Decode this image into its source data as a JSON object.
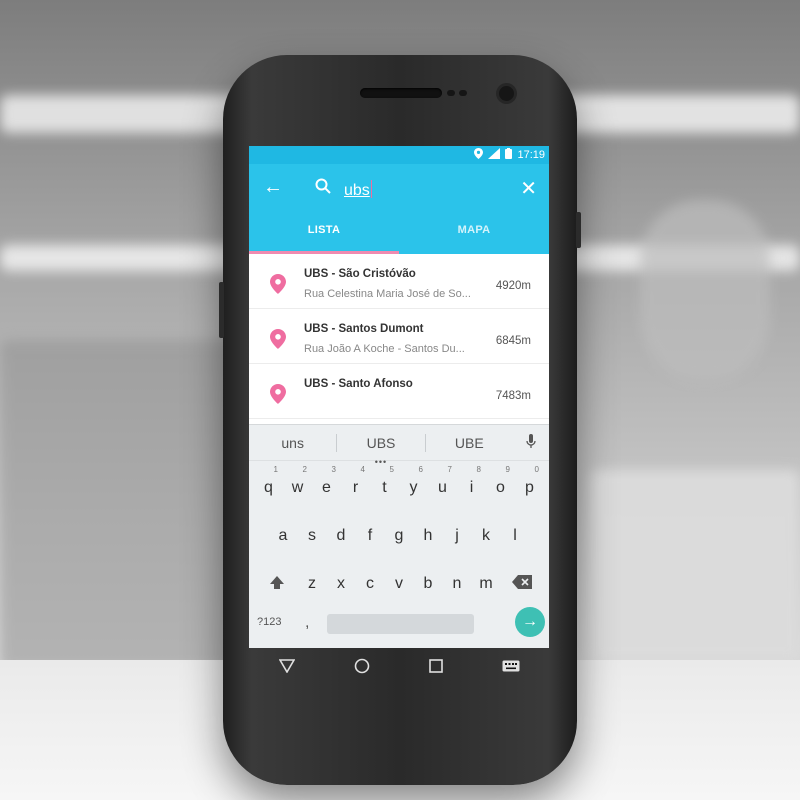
{
  "status_bar": {
    "time": "17:19"
  },
  "search": {
    "query": "ubs",
    "back_icon": "arrow-back-icon",
    "search_icon": "search-icon",
    "close_icon": "close-icon"
  },
  "tabs": [
    {
      "label": "LISTA",
      "active": true
    },
    {
      "label": "MAPA",
      "active": false
    }
  ],
  "results": [
    {
      "name": "UBS - São Cristóvão",
      "address": "Rua Celestina Maria José de So...",
      "distance": "4920m"
    },
    {
      "name": "UBS - Santos Dumont",
      "address": "Rua João A Koche - Santos Du...",
      "distance": "6845m"
    },
    {
      "name": "UBS - Santo Afonso",
      "address": "",
      "distance": "7483m"
    }
  ],
  "keyboard": {
    "suggestions": [
      "uns",
      "UBS",
      "UBE"
    ],
    "row1": [
      {
        "key": "q",
        "num": "1"
      },
      {
        "key": "w",
        "num": "2"
      },
      {
        "key": "e",
        "num": "3"
      },
      {
        "key": "r",
        "num": "4"
      },
      {
        "key": "t",
        "num": "5"
      },
      {
        "key": "y",
        "num": "6"
      },
      {
        "key": "u",
        "num": "7"
      },
      {
        "key": "i",
        "num": "8"
      },
      {
        "key": "o",
        "num": "9"
      },
      {
        "key": "p",
        "num": "0"
      }
    ],
    "row2": [
      "a",
      "s",
      "d",
      "f",
      "g",
      "h",
      "j",
      "k",
      "l"
    ],
    "row3": [
      "z",
      "x",
      "c",
      "v",
      "b",
      "n",
      "m"
    ],
    "symbols_label": "?123",
    "comma": ","
  },
  "colors": {
    "accent": "#2bc3ea",
    "status": "#1fb8e3",
    "pin": "#ef6da0",
    "enter": "#3ec0b4"
  }
}
